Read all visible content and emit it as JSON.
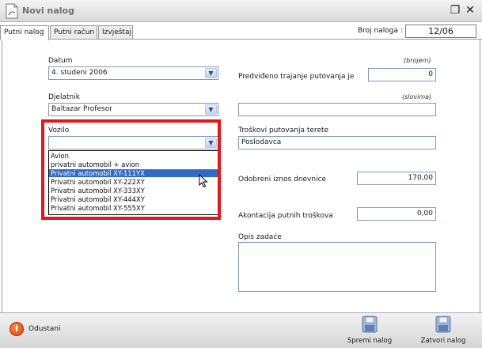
{
  "window": {
    "title": "Novi nalog",
    "maximize_glyph": "❐",
    "close_glyph": "✕"
  },
  "tabs": [
    {
      "label": "Putni nalog",
      "active": true
    },
    {
      "label": "Putni račun",
      "active": false
    },
    {
      "label": "Izvještaj",
      "active": false
    }
  ],
  "broj_naloga": {
    "label": "Broj naloga :",
    "value": "12/06"
  },
  "datum": {
    "label": "Datum",
    "value": "4. studeni 2006"
  },
  "djelatnik": {
    "label": "Djelatnik",
    "value": "Baltazar Profesor"
  },
  "vozilo": {
    "label": "Vozilo",
    "value": "",
    "options": [
      {
        "label": "Avion",
        "selected": false
      },
      {
        "label": "privatni automobil + avion",
        "selected": false
      },
      {
        "label": "Privatni automobil XY-111YX",
        "selected": true
      },
      {
        "label": "Privatni automobil XY-222XY",
        "selected": false
      },
      {
        "label": "Privatni automobil XY-333XY",
        "selected": false
      },
      {
        "label": "Privatni automobil XY-444XY",
        "selected": false
      },
      {
        "label": "Privatni automobil XY-555XY",
        "selected": false
      }
    ]
  },
  "trajanje": {
    "label": "Predviđeno trajanje putovanja je",
    "hint_number": "(brojem)",
    "value_number": "0",
    "hint_words": "(slovima)",
    "value_words": ""
  },
  "troskovi": {
    "label": "Troškovi putovanja terete",
    "value": "Poslodavca"
  },
  "dnevnice": {
    "label": "Odobreni iznos dnevnice",
    "value": "170,00"
  },
  "akontacija": {
    "label": "Akontacija putnih troškova",
    "value": "0,00"
  },
  "opis": {
    "label": "Opis zadaće",
    "value": ""
  },
  "footer": {
    "cancel_label": "Odustani",
    "save_label": "Spremi nalog",
    "close_label": "Zatvori nalog"
  },
  "colors": {
    "highlight": "#e4161b",
    "selection": "#316ac5"
  },
  "icons": {
    "app": "document-icon",
    "cancel": "power-icon",
    "save": "floppy-disk-icon",
    "close": "floppy-disk-icon"
  }
}
